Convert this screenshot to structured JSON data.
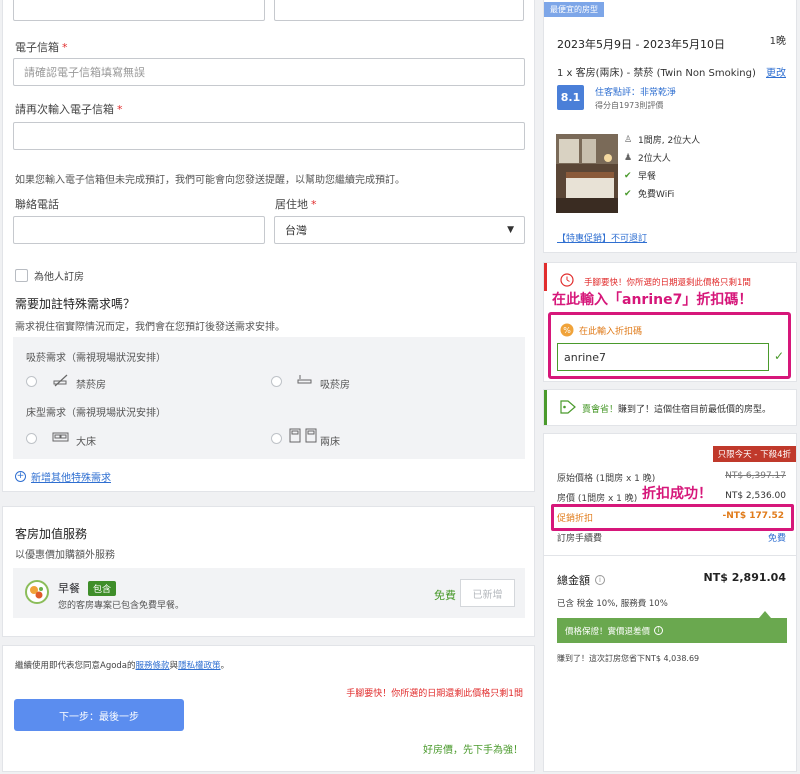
{
  "form": {
    "email_label": "電子信箱",
    "email_required": "*",
    "email_placeholder": "請確認電子信箱填寫無誤",
    "email_confirm_label": "請再次輸入電子信箱",
    "email_confirm_required": "*",
    "reminder_note": "如果您輸入電子信箱但未完成預訂，我們可能會向您發送提醒，以幫助您繼續完成預訂。",
    "phone_label": "聯絡電話",
    "country_label": "居住地",
    "country_required": "*",
    "country_value": "台灣",
    "book_for_other_label": "為他人訂房"
  },
  "special_requests": {
    "title": "需要加註特殊需求嗎？",
    "note": "需求視住宿實際情況而定，我們會在您預訂後發送需求安排。",
    "smoking_title": "吸菸需求（需視現場狀況安排）",
    "non_smoking": "禁菸房",
    "smoking": "吸菸房",
    "bed_title": "床型需求（需視現場狀況安排）",
    "big_bed": "大床",
    "twin_bed": "兩床",
    "add_more": "新增其他特殊需求"
  },
  "addons": {
    "title": "客房加值服務",
    "subtitle": "以優惠價加購額外服務",
    "breakfast_name": "早餐",
    "breakfast_badge": "包含",
    "breakfast_desc": "您的客房專案已包含免費早餐。",
    "free_label": "免費",
    "added_button": "已新增"
  },
  "footer": {
    "terms_prefix": "繼續使用即代表您同意Agoda的",
    "terms_link": "服務條款",
    "terms_and": "與",
    "privacy_link": "隱私權政策",
    "terms_suffix": "。",
    "urgency": "手腳要快！你所選的日期還剩此價格只剩1間",
    "next_button": "下一步：最後一步",
    "tagline": "好房價，先下手為強！"
  },
  "summary": {
    "cheapest_badge": "最便宜的房型",
    "dates": "2023年5月9日 - 2023年5月10日",
    "nights": "1晚",
    "room_name": "1 x 客房(兩床) - 禁菸 (Twin Non Smoking)",
    "change_link": "更改",
    "score": "8.1",
    "score_label": "住客點評：非常乾淨",
    "score_count": "得分自1973則評價",
    "feature_1": "1間房, 2位大人",
    "feature_2": "2位大人",
    "feature_3": "早餐",
    "feature_4": "免費WiFi",
    "promo_link": "【特惠促銷】不可退訂"
  },
  "alerts": {
    "urgency": "手腳要快！你所選的日期還剩此價格只剩1間",
    "annotation_code": "在此輸入「anrine7」折扣碼！",
    "promo_label": "在此輸入折扣碼",
    "promo_value": "anrine7",
    "good_deal": "賺到了！這個住宿目前最低價的房型。",
    "good_deal_strong": "賣會省！"
  },
  "pricing": {
    "flash_badge": "只限今天 - 下殺4折",
    "original_label": "原始價格 (1間房 x 1 晚)",
    "original_price": "NT$ 6,397.17",
    "room_label": "房價 (1間房 x 1 晚)",
    "room_price": "NT$ 2,536.00",
    "annotation_success": "折扣成功！",
    "discount_label": "促銷折扣",
    "discount_value": "-NT$ 177.52",
    "booking_fee_label": "訂房手續費",
    "booking_fee_value": "免費",
    "total_label": "總金額",
    "total_value": "NT$ 2,891.04",
    "tax_note": "已含 稅金 10%, 服務費 10%",
    "guarantee": "價格保證！實價退差價",
    "saving_note": "賺到了！這次訂房您省下NT$ 4,038.69"
  },
  "colors": {
    "accent_pink": "#d6177a",
    "link_blue": "#2f6fd1",
    "green": "#4a9a2c",
    "red": "#e12d2d",
    "button_blue": "#5b8def"
  }
}
